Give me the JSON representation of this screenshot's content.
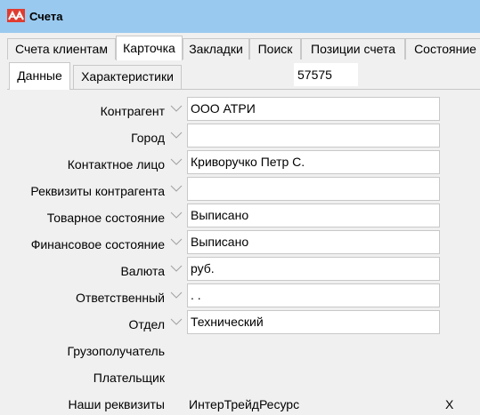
{
  "window": {
    "title": "Счета",
    "icon": "app-logo-icon"
  },
  "tabs": [
    {
      "label": "Счета клиентам"
    },
    {
      "label": "Карточка"
    },
    {
      "label": "Закладки"
    },
    {
      "label": "Поиск"
    },
    {
      "label": "Позиции счета"
    },
    {
      "label": "Состояние"
    }
  ],
  "active_tab": "Карточка",
  "subtabs": [
    {
      "label": "Данные"
    },
    {
      "label": "Характеристики"
    }
  ],
  "active_subtab": "Данные",
  "doc_number": "57575",
  "fields": [
    {
      "label": "Контрагент",
      "value": "ООО АТРИ"
    },
    {
      "label": "Город",
      "value": ""
    },
    {
      "label": "Контактное лицо",
      "value": "Криворучко Петр С."
    },
    {
      "label": "Реквизиты контрагента",
      "value": ""
    },
    {
      "label": "Товарное состояние",
      "value": "Выписано"
    },
    {
      "label": "Финансовое состояние",
      "value": "Выписано"
    },
    {
      "label": "Валюта",
      "value": "руб."
    },
    {
      "label": "Ответственный",
      "value": ". ."
    },
    {
      "label": "Отдел",
      "value": "Технический"
    }
  ],
  "static_fields": [
    {
      "label": "Грузополучатель",
      "value": ""
    },
    {
      "label": "Плательщик",
      "value": ""
    },
    {
      "label": "Наши реквизиты",
      "value": "ИнтерТрейдРесурс",
      "remove": "X"
    }
  ],
  "colors": {
    "titlebar": "#99c9ef",
    "logo": "#e03c31"
  }
}
